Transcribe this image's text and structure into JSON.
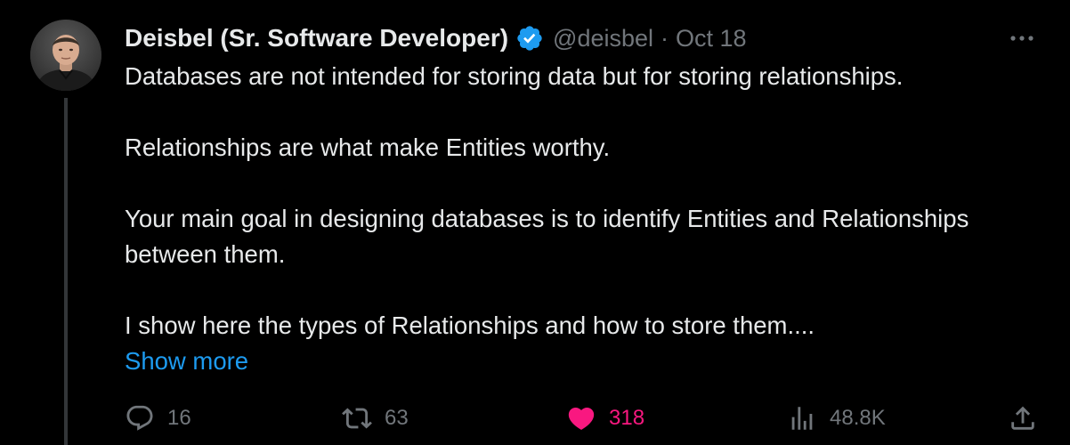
{
  "author": {
    "display_name": "Deisbel (Sr. Software Developer)",
    "handle": "@deisbel",
    "separator": "·",
    "date": "Oct 18",
    "verified": true,
    "verified_color": "#1d9bf0"
  },
  "tweet": {
    "paragraphs": [
      "Databases are not intended for storing data but for storing relationships.",
      "Relationships are what make Entities worthy.",
      "Your main goal in designing databases is to identify Entities and Relationships between them.",
      "I show here the types of Relationships and how to store them...."
    ],
    "show_more_label": "Show more"
  },
  "actions": {
    "replies": "16",
    "retweets": "63",
    "likes": "318",
    "liked": true,
    "views": "48.8K"
  },
  "icons": {
    "more": "more-horizontal-icon",
    "reply": "reply-icon",
    "retweet": "retweet-icon",
    "like": "heart-icon",
    "views": "analytics-icon",
    "share": "share-icon"
  },
  "colors": {
    "background": "#000000",
    "text": "#e7e9ea",
    "secondary": "#71767b",
    "link": "#1d9bf0",
    "like": "#f91880"
  }
}
